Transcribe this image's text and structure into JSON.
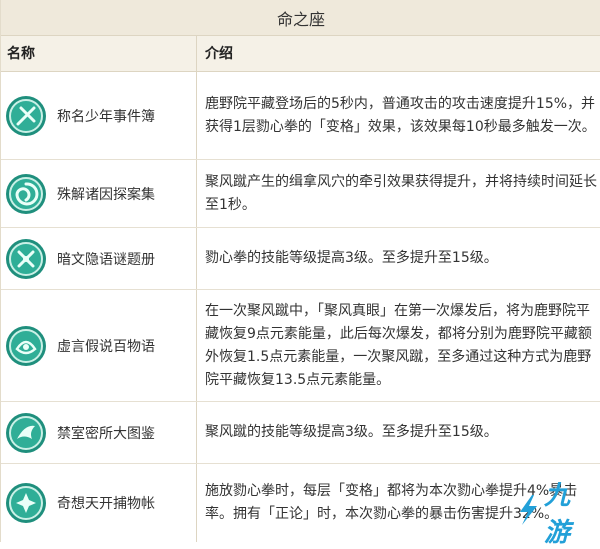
{
  "title": "命之座",
  "headers": {
    "name": "名称",
    "desc": "介绍"
  },
  "rows": [
    {
      "name": "称名少年事件簿",
      "icon": "constellation-1-icon",
      "desc": "鹿野院平藏登场后的5秒内，普通攻击的攻击速度提升15%，并获得1层勠心拳的「变格」效果，该效果每10秒最多触发一次。"
    },
    {
      "name": "殊解诸因探案集",
      "icon": "constellation-2-icon",
      "desc": "聚风蹴产生的缉拿风穴的牵引效果获得提升，并将持续时间延长至1秒。"
    },
    {
      "name": "暗文隐语谜题册",
      "icon": "constellation-3-icon",
      "desc": "勠心拳的技能等级提高3级。至多提升至15级。"
    },
    {
      "name": "虚言假说百物语",
      "icon": "constellation-4-icon",
      "desc": "在一次聚风蹴中，「聚风真眼」在第一次爆发后，将为鹿野院平藏恢复9点元素能量，此后每次爆发，都将分别为鹿野院平藏额外恢复1.5点元素能量，一次聚风蹴，至多通过这种方式为鹿野院平藏恢复13.5点元素能量。"
    },
    {
      "name": "禁室密所大图鉴",
      "icon": "constellation-5-icon",
      "desc": "聚风蹴的技能等级提高3级。至多提升至15级。"
    },
    {
      "name": "奇想天开捕物帐",
      "icon": "constellation-6-icon",
      "desc": "施放勠心拳时，每层「变格」都将为本次勠心拳提升4%暴击率。拥有「正论」时，本次勠心拳的暴击伤害提升32%。"
    }
  ],
  "watermark": {
    "text": "九游",
    "icon": "jiuyou-logo-icon"
  },
  "colors": {
    "icon_bg": "#1f8f7d",
    "icon_ring": "#c9f0e6",
    "accent": "#22a0d8"
  }
}
